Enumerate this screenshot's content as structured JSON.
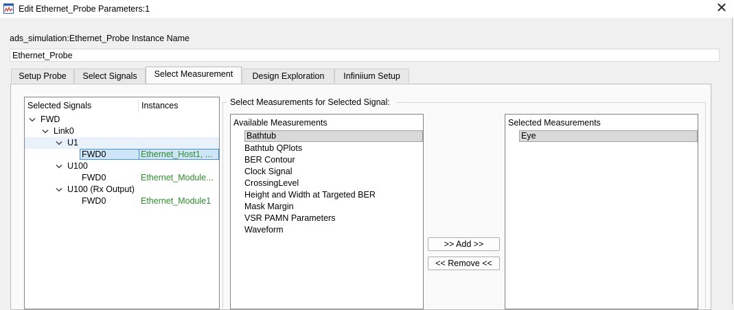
{
  "window": {
    "title": "Edit Ethernet_Probe Parameters:1",
    "close_glyph": "✕",
    "app_icon": "ads-app-icon"
  },
  "instance": {
    "label": "ads_simulation:Ethernet_Probe Instance Name",
    "value": "Ethernet_Probe"
  },
  "tabs": [
    {
      "label": "Setup Probe",
      "active": false
    },
    {
      "label": "Select Signals",
      "active": false
    },
    {
      "label": "Select Measurement",
      "active": true
    },
    {
      "label": "Design Exploration",
      "active": false
    },
    {
      "label": "Infiniium Setup",
      "active": false
    }
  ],
  "signals_tree": {
    "col_signals": "Selected Signals",
    "col_instances": "Instances",
    "nodes": [
      {
        "label": "FWD",
        "expanded": true
      },
      {
        "label": "Link0",
        "expanded": true
      },
      {
        "label": "U1",
        "expanded": true
      },
      {
        "label": "FWD0",
        "instance": "Ethernet_Host1, ...",
        "selected": true
      },
      {
        "label": "U100",
        "expanded": true
      },
      {
        "label": "FWD0",
        "instance": "Ethernet_Module..."
      },
      {
        "label": "U100 (Rx Output)",
        "expanded": true
      },
      {
        "label": "FWD0",
        "instance": "Ethernet_Module1"
      }
    ]
  },
  "measurements": {
    "group_title": "Select Measurements for Selected Signal:",
    "available_header": "Available Measurements",
    "available": [
      "Bathtub",
      "Bathtub QPlots",
      "BER Contour",
      "Clock Signal",
      "CrossingLevel",
      "Height and Width at Targeted BER",
      "Mask Margin",
      "VSR PAMN Parameters",
      "Waveform"
    ],
    "available_selected": "Bathtub",
    "selected_header": "Selected Measurements",
    "selected": [
      "Eye"
    ],
    "add_label": ">> Add >>",
    "remove_label": "<< Remove <<"
  },
  "colors": {
    "instance_text": "#2e8b2e",
    "selection_highlight": "#cce5f7",
    "selection_border": "#4a90d9"
  }
}
